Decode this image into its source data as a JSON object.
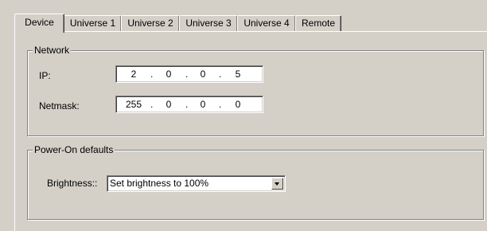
{
  "tabs": [
    {
      "label": "Device",
      "active": true
    },
    {
      "label": "Universe 1",
      "active": false
    },
    {
      "label": "Universe 2",
      "active": false
    },
    {
      "label": "Universe 3",
      "active": false
    },
    {
      "label": "Universe 4",
      "active": false
    },
    {
      "label": "Remote",
      "active": false
    }
  ],
  "network": {
    "legend": "Network",
    "ip_label": "IP:",
    "ip_octets": [
      "2",
      "0",
      "0",
      "5"
    ],
    "netmask_label": "Netmask:",
    "netmask_octets": [
      "255",
      "0",
      "0",
      "0"
    ],
    "separator": "."
  },
  "power_on": {
    "legend": "Power-On defaults",
    "brightness_label": "Brightness::",
    "brightness_value": "Set brightness to 100%"
  },
  "icons": {
    "dropdown": "chevron-down-icon"
  }
}
